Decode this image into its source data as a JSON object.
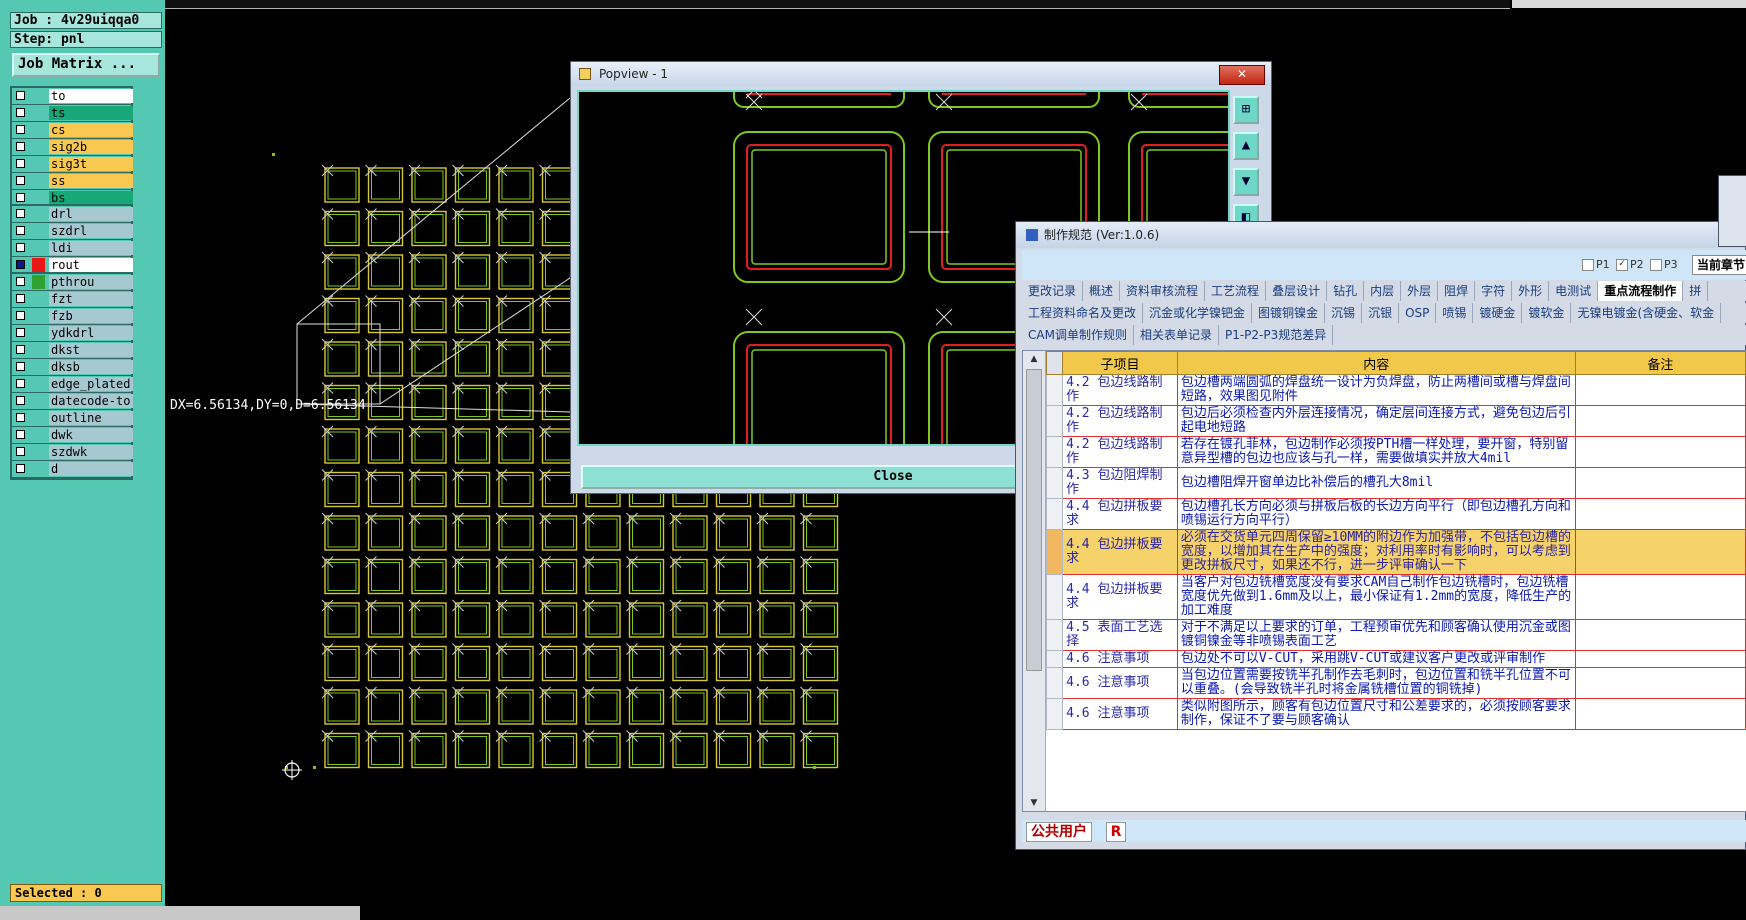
{
  "left_panel": {
    "job": "Job : 4v29uiqqa0",
    "step": "Step: pnl",
    "matrix_label": "Job Matrix ...",
    "selected": "Selected : 0",
    "groups": [
      [
        {
          "name": "to",
          "color": "#ffffff"
        },
        {
          "name": "ts",
          "color": "#18a878"
        },
        {
          "name": "cs",
          "color": "#f8c850"
        },
        {
          "name": "sig2b",
          "color": "#f8c850"
        },
        {
          "name": "sig3t",
          "color": "#f8c850"
        },
        {
          "name": "ss",
          "color": "#f8c850"
        },
        {
          "name": "bs",
          "color": "#18a878"
        }
      ],
      [
        {
          "name": "drl",
          "color": "#a6c8d0"
        },
        {
          "name": "szdrl",
          "color": "#a6c8d0"
        },
        {
          "name": "ldi",
          "color": "#a6c8d0"
        },
        {
          "name": "rout",
          "color": "#ffffff",
          "active": true,
          "swatch": "#e81818"
        }
      ],
      [
        {
          "name": "pthrou",
          "color": "#a6c8d0",
          "swatch": "#30a030"
        },
        {
          "name": "fzt",
          "color": "#a6c8d0"
        },
        {
          "name": "fzb",
          "color": "#a6c8d0"
        },
        {
          "name": "ydkdrl",
          "color": "#a6c8d0"
        },
        {
          "name": "dkst",
          "color": "#a6c8d0"
        },
        {
          "name": "dksb",
          "color": "#a6c8d0"
        },
        {
          "name": "edge_plated",
          "color": "#a6c8d0"
        },
        {
          "name": "datecode-to",
          "color": "#a6c8d0"
        },
        {
          "name": "outline",
          "color": "#a6c8d0"
        },
        {
          "name": "dwk",
          "color": "#a6c8d0"
        },
        {
          "name": "szdwk",
          "color": "#a6c8d0"
        },
        {
          "name": "d",
          "color": "#a6c8d0"
        }
      ]
    ]
  },
  "measure_text": "DX=6.56134,DY=0,D=6.56134",
  "popview": {
    "title": "Popview - 1",
    "close_x": "✕",
    "close_label": "Close"
  },
  "spec": {
    "title": "制作规范 (Ver:1.0.6)",
    "p_checks": [
      {
        "label": "P1",
        "checked": false
      },
      {
        "label": "P2",
        "checked": true
      },
      {
        "label": "P3",
        "checked": false
      }
    ],
    "current_section": "当前章节",
    "tab_rows": [
      [
        "更改记录",
        "概述",
        "资料审核流程",
        "工艺流程",
        "叠层设计",
        "钻孔",
        "内层",
        "外层",
        "阻焊",
        "字符",
        "外形",
        "电测试",
        "重点流程制作",
        "拼"
      ],
      [
        "工程资料命名及更改",
        "沉金或化学镍钯金",
        "图镀铜镍金",
        "沉锡",
        "沉银",
        "OSP",
        "喷锡",
        "镀硬金",
        "镀软金",
        "无镍电镀金(含硬金、软金"
      ],
      [
        "CAM调单制作规则",
        "相关表单记录",
        "P1-P2-P3规范差异"
      ]
    ],
    "selected_tab": "重点流程制作",
    "columns": [
      "子项目",
      "内容",
      "备注"
    ],
    "rows": [
      {
        "sub": "4.2 包边线路制作",
        "content": "包边槽两端圆弧的焊盘统一设计为负焊盘，防止两槽间或槽与焊盘间短路，效果图见附件",
        "note": ""
      },
      {
        "sub": "4.2 包边线路制作",
        "content": "包边后必须检查内外层连接情况，确定层间连接方式，避免包边后引起电地短路",
        "note": ""
      },
      {
        "sub": "4.2 包边线路制作",
        "content": "若存在镀孔菲林，包边制作必须按PTH槽一样处理，要开窗，特别留意异型槽的包边也应该与孔一样，需要做填实并放大4mil",
        "note": ""
      },
      {
        "sub": "4.3 包边阻焊制作",
        "content": "包边槽阻焊开窗单边比补偿后的槽孔大8mil",
        "note": ""
      },
      {
        "sub": "4.4 包边拼板要求",
        "content": "包边槽孔长方向必须与拼板后板的长边方向平行（即包边槽孔方向和喷锡运行方向平行）",
        "note": ""
      },
      {
        "sub": "4.4 包边拼板要求",
        "content": "必须在交货单元四周保留≥10MM的附边作为加强带，不包括包边槽的宽度，以增加其在生产中的强度；对利用率时有影响时，可以考虑到更改拼板尺寸，如果还不行，进一步评审确认一下",
        "note": "",
        "highlight": true
      },
      {
        "sub": "4.4 包边拼板要求",
        "content": "当客户对包边铣槽宽度没有要求CAM自己制作包边铣槽时，包边铣槽宽度优先做到1.6mm及以上，最小保证有1.2mm的宽度，降低生产的加工难度",
        "note": ""
      },
      {
        "sub": "4.5 表面工艺选择",
        "content": "对于不满足以上要求的订单，工程预审优先和顾客确认使用沉金或图镀铜镍金等非喷锡表面工艺",
        "note": ""
      },
      {
        "sub": "4.6 注意事项",
        "content": "包边处不可以V-CUT，采用跳V-CUT或建议客户更改或评审制作",
        "note": ""
      },
      {
        "sub": "4.6 注意事项",
        "content": "当包边位置需要按铣半孔制作去毛刺时，包边位置和铣半孔位置不可以重叠。(会导致铣半孔时将金属铣槽位置的铜铣掉)",
        "note": ""
      },
      {
        "sub": "4.6 注意事项",
        "content": "类似附图所示，顾客有包边位置尺寸和公差要求的，必须按顾客要求制作，保证不了要与顾客确认",
        "note": ""
      }
    ],
    "user_label": "公共用户",
    "r_badge": "R"
  },
  "colors": {
    "panel_bg": "#55c8b4",
    "route_red": "#e02020",
    "outline_green": "#7ec820",
    "pad_yellow": "#d8c830",
    "highlight_row": "#f6d26a"
  }
}
